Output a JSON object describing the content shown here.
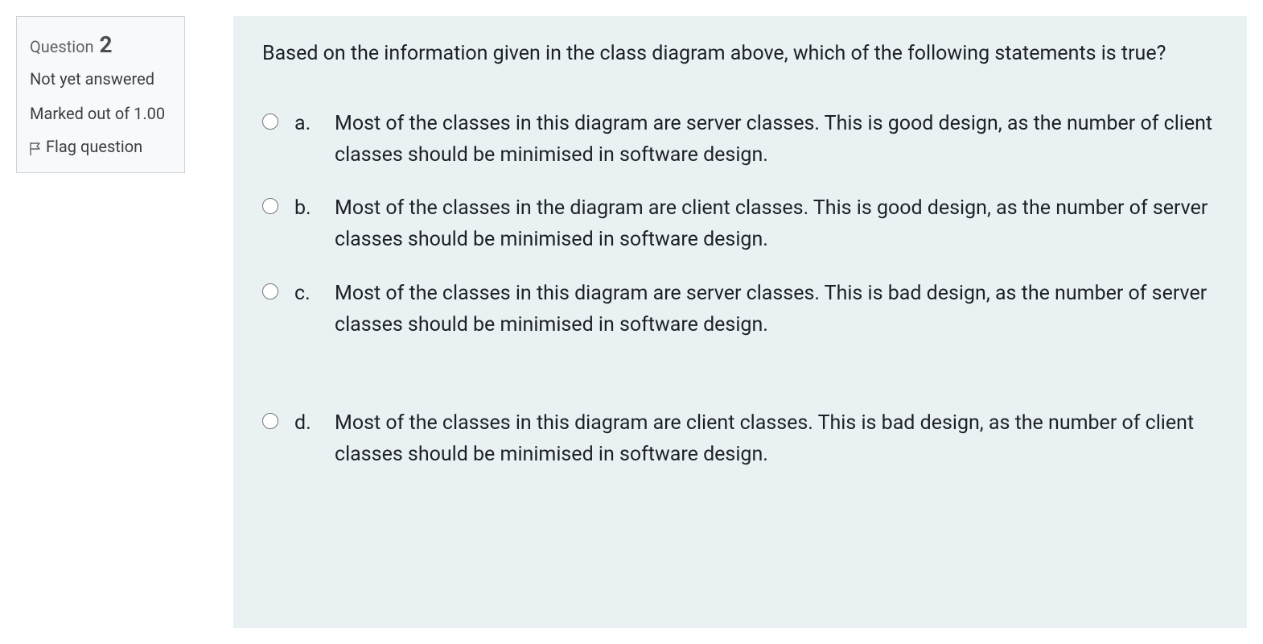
{
  "info": {
    "question_label": "Question",
    "question_number": "2",
    "status": "Not yet answered",
    "marked": "Marked out of 1.00",
    "flag": "Flag question"
  },
  "question": {
    "text": "Based on the information given in the class diagram above, which of the following statements is true?",
    "answers": [
      {
        "letter": "a.",
        "text": "Most of the classes in this diagram are server classes. This is good design, as the number of client classes should be minimised in software design."
      },
      {
        "letter": "b.",
        "text": "Most of the classes in the diagram are client classes. This is good design, as the number of server classes should be minimised in software design."
      },
      {
        "letter": "c.",
        "text": "Most of the classes in this diagram are server classes. This is bad design, as the number of server classes should be minimised in software design."
      },
      {
        "letter": "d.",
        "text": "Most of the classes in this diagram are client classes. This is bad design, as the number of client classes should be minimised in software design."
      }
    ]
  }
}
